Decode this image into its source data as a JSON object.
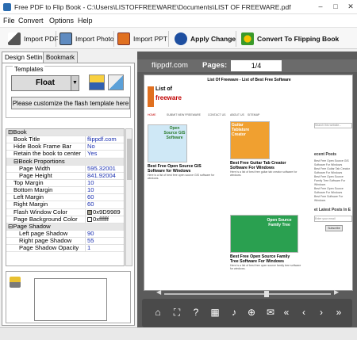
{
  "window": {
    "title": "Free PDF to Flip Book - C:\\Users\\LISTOFFREEWARE\\Documents\\LIST OF FREEWARE.pdf",
    "minimize_glyph": "–",
    "maximize_glyph": "□",
    "close_glyph": "✕"
  },
  "menu": {
    "items": [
      "File",
      "Convert",
      "Options",
      "Help"
    ]
  },
  "toolbar": {
    "import_pdf": "Import PDF",
    "import_photo": "Import Photo",
    "import_ppt": "Import PPT",
    "apply_change": "Apply Change",
    "convert": "Convert To Flipping Book"
  },
  "tabs": {
    "design": "Design Setting",
    "bookmark": "Bookmark"
  },
  "templates": {
    "label": "Templates",
    "selected": "Float",
    "customize": "Please customize the flash template here"
  },
  "properties": [
    {
      "key": "Book",
      "value": "",
      "group": true,
      "indent": 0
    },
    {
      "key": "Book Title",
      "value": "flippdf.com",
      "group": false,
      "indent": 1
    },
    {
      "key": "Hide Book Frame Bar",
      "value": "No",
      "group": false,
      "indent": 1
    },
    {
      "key": "Retain the book to center",
      "value": "Yes",
      "group": false,
      "indent": 1
    },
    {
      "key": "Book Proportions",
      "value": "",
      "group": true,
      "indent": 1
    },
    {
      "key": "Page Width",
      "value": "595.32001",
      "group": false,
      "indent": 2
    },
    {
      "key": "Page Height",
      "value": "841.92004",
      "group": false,
      "indent": 2
    },
    {
      "key": "Top Margin",
      "value": "10",
      "group": false,
      "indent": 1
    },
    {
      "key": "Bottom Margin",
      "value": "10",
      "group": false,
      "indent": 1
    },
    {
      "key": "Left Margin",
      "value": "60",
      "group": false,
      "indent": 1
    },
    {
      "key": "Right Margin",
      "value": "60",
      "group": false,
      "indent": 1
    },
    {
      "key": "Flash Window Color",
      "value": "0x9D9989",
      "group": false,
      "indent": 1,
      "swatch": "#9D9989"
    },
    {
      "key": "Page Background Color",
      "value": "0xffffff",
      "group": false,
      "indent": 1,
      "swatch": "#ffffff"
    },
    {
      "key": "Page Shadow",
      "value": "",
      "group": true,
      "indent": 0
    },
    {
      "key": "Left page Shadow",
      "value": "90",
      "group": false,
      "indent": 2
    },
    {
      "key": "Right page Shadow",
      "value": "55",
      "group": false,
      "indent": 2
    },
    {
      "key": "Page Shadow Opacity",
      "value": "1",
      "group": false,
      "indent": 2
    }
  ],
  "viewer": {
    "brand": "flippdf.com",
    "pages_label": "Pages:",
    "page_indicator": "1/4"
  },
  "page_content": {
    "header": "List Of Freeware - List of Best Free Software",
    "logo_top": "List of",
    "logo_bottom": "freeware",
    "nav": [
      "HOME",
      "SUBMIT NEW FREEWARE",
      "CONTACT US",
      "ABOUT US",
      "SITEMAP"
    ],
    "search_placeholder": "Search this website...",
    "cards": [
      {
        "img_text": "Open Source GIS Software",
        "title": "Best Free Open Source GIS Software for Windows",
        "desc": "Here is a list of best free open source GIS software for windows."
      },
      {
        "img_text": "Guitar Tablature Creator",
        "title": "Best Free Guitar Tab Creator Software For Windows",
        "desc": "Here is a list of best free guitar tab creator software for windows."
      },
      {
        "img_text": "Open Source Family Tree",
        "title": "Best Free Open Source Family Tree Software For Windows",
        "desc": "Here is a list of best free open source family tree software for windows."
      }
    ],
    "sidebar": {
      "recent_posts": "ecent Posts",
      "recent_items": [
        "Best Free Open Source GIS Software For Windows",
        "Best Free Guitar Tab Creator Software For Windows",
        "Best Free Open Source Family Tree Software For Windows",
        "Best Free Open Source Software For Windows",
        "Best Free Software For Windows"
      ],
      "latest_posts": "et Latest Posts In E",
      "email_placeholder": "Enter your email",
      "subscribe": "Subscribe"
    }
  },
  "colors": {
    "viewer_bg": "#5b5b5b",
    "accent": "#c00000",
    "link": "#1a2fb0"
  }
}
